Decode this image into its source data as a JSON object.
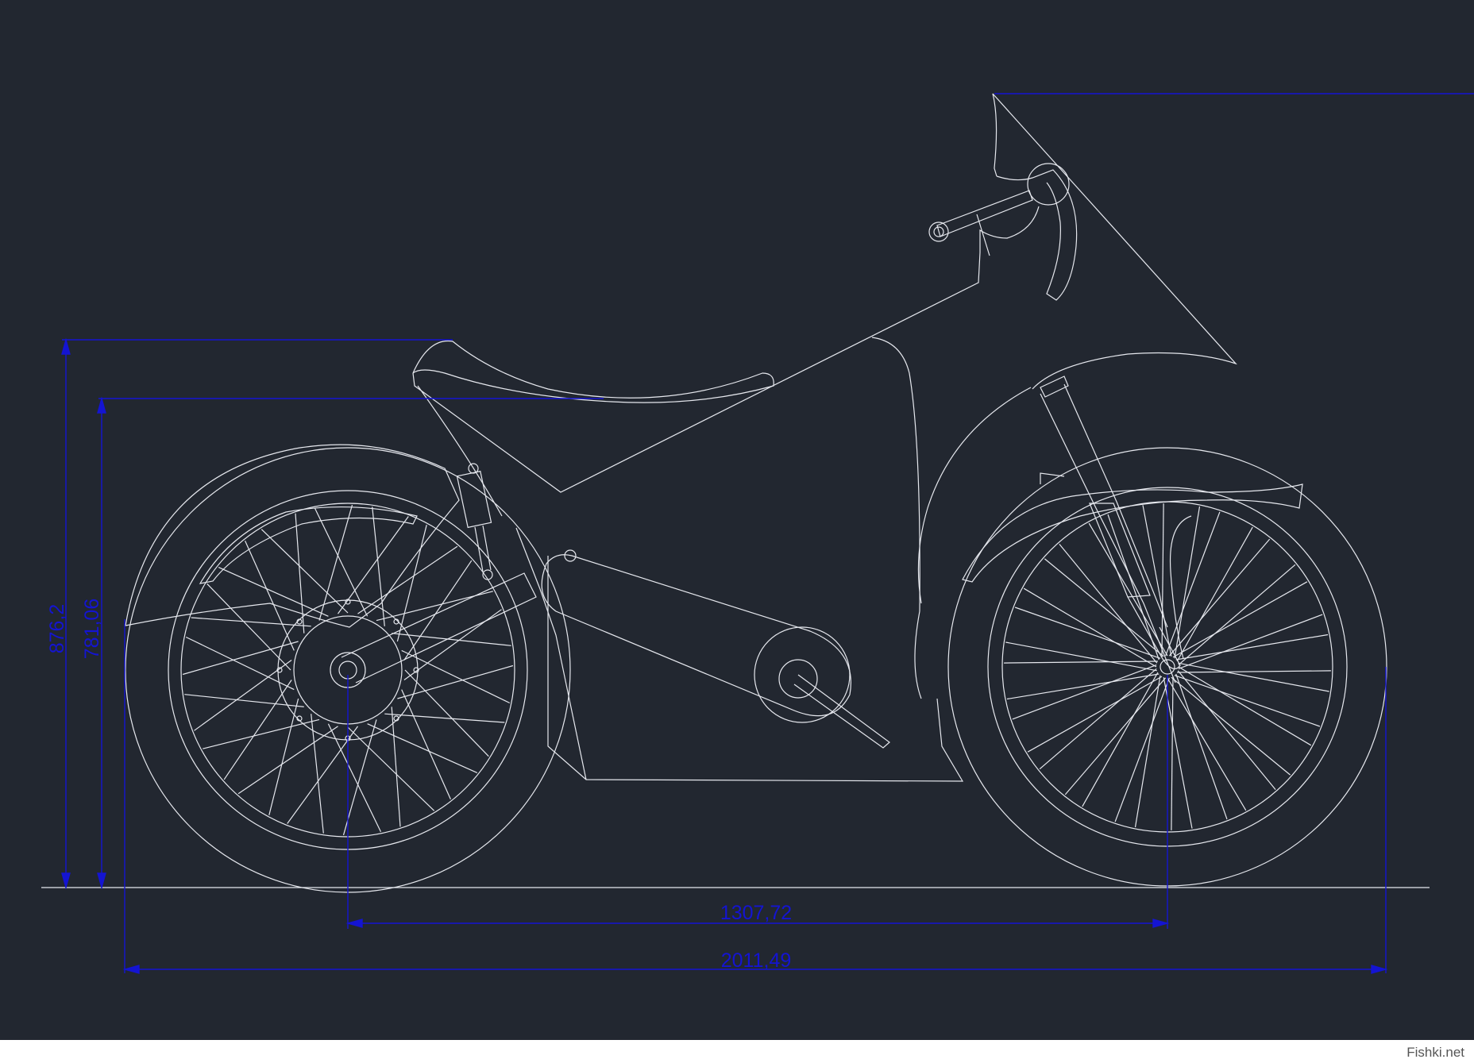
{
  "colors": {
    "background": "#222730",
    "drawing_line": "#e6e8ee",
    "dimension_line": "#1414d2"
  },
  "dimensions": {
    "overall_height": "876,2",
    "seat_height": "781,06",
    "wheelbase": "1307,72",
    "overall_length": "2011,49"
  },
  "footer": {
    "watermark": "Fishki.net"
  }
}
